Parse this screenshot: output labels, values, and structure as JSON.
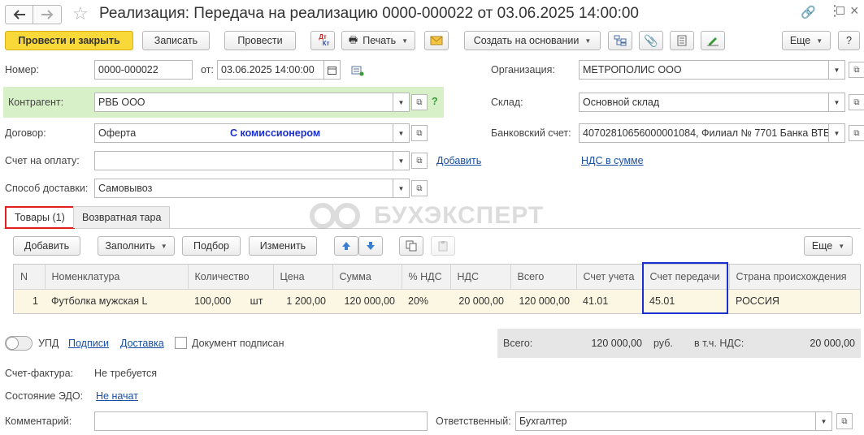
{
  "window": {
    "title": "Реализация: Передача на реализацию 0000-000022 от 03.06.2025 14:00:00"
  },
  "toolbar": {
    "post_close": "Провести и закрыть",
    "save": "Записать",
    "post": "Провести",
    "dt_kt_top": "Дт",
    "dt_kt_bottom": "Кт",
    "print": "Печать",
    "create_based": "Создать на основании",
    "more": "Еще",
    "help": "?"
  },
  "form": {
    "number_label": "Номер:",
    "number_value": "0000-000022",
    "date_label": "от:",
    "date_value": "03.06.2025 14:00:00",
    "org_label": "Организация:",
    "org_value": "МЕТРОПОЛИС ООО",
    "counterparty_label": "Контрагент:",
    "counterparty_value": "РВБ ООО",
    "counterparty_help": "?",
    "warehouse_label": "Склад:",
    "warehouse_value": "Основной склад",
    "contract_label": "Договор:",
    "contract_value": "Оферта",
    "contract_note": "С комиссионером",
    "bank_label": "Банковский счет:",
    "bank_value": "40702810656000001084, Филиал № 7701 Банка ВТБ",
    "invoice_label": "Счет на оплату:",
    "invoice_value": "",
    "invoice_add": "Добавить",
    "vat_link": "НДС в сумме",
    "delivery_label": "Способ доставки:",
    "delivery_value": "Самовывоз"
  },
  "tabs": [
    {
      "label": "Товары (1)",
      "active": true
    },
    {
      "label": "Возвратная тара",
      "active": false
    }
  ],
  "watermark": "БУХЭКСПЕРТ",
  "table_toolbar": {
    "add": "Добавить",
    "fill": "Заполнить",
    "select": "Подбор",
    "change": "Изменить",
    "more": "Еще"
  },
  "table": {
    "columns": [
      "N",
      "Номенклатура",
      "Количество",
      "Цена",
      "Сумма",
      "% НДС",
      "НДС",
      "Всего",
      "Счет учета",
      "Счет передачи",
      "Страна происхождения"
    ],
    "rows": [
      [
        "1",
        "Футболка мужская L",
        "100,000",
        "1 200,00",
        "120 000,00",
        "20%",
        "20 000,00",
        "120 000,00",
        "41.01",
        "45.01",
        "РОССИЯ"
      ]
    ],
    "unit": "шт"
  },
  "footer": {
    "upd": "УПД",
    "signatures": "Подписи",
    "delivery": "Доставка",
    "doc_signed": "Документ подписан",
    "total_label": "Всего:",
    "total_value": "120 000,00",
    "currency": "руб.",
    "vat_incl_label": "в т.ч. НДС:",
    "vat_incl_value": "20 000,00",
    "invoice_label": "Счет-фактура:",
    "invoice_value": "Не требуется",
    "edo_label": "Состояние ЭДО:",
    "edo_value": "Не начат",
    "comment_label": "Комментарий:",
    "comment_value": "",
    "responsible_label": "Ответственный:",
    "responsible_value": "Бухгалтер"
  },
  "colors": {
    "primary_button": "#f9d83a",
    "link": "#1a4fa3",
    "counterparty_bg": "#d8f0c8",
    "active_tab_border": "#e02020",
    "highlight_column_border": "#1a2fd0",
    "row_bg": "#fbf7e2"
  }
}
